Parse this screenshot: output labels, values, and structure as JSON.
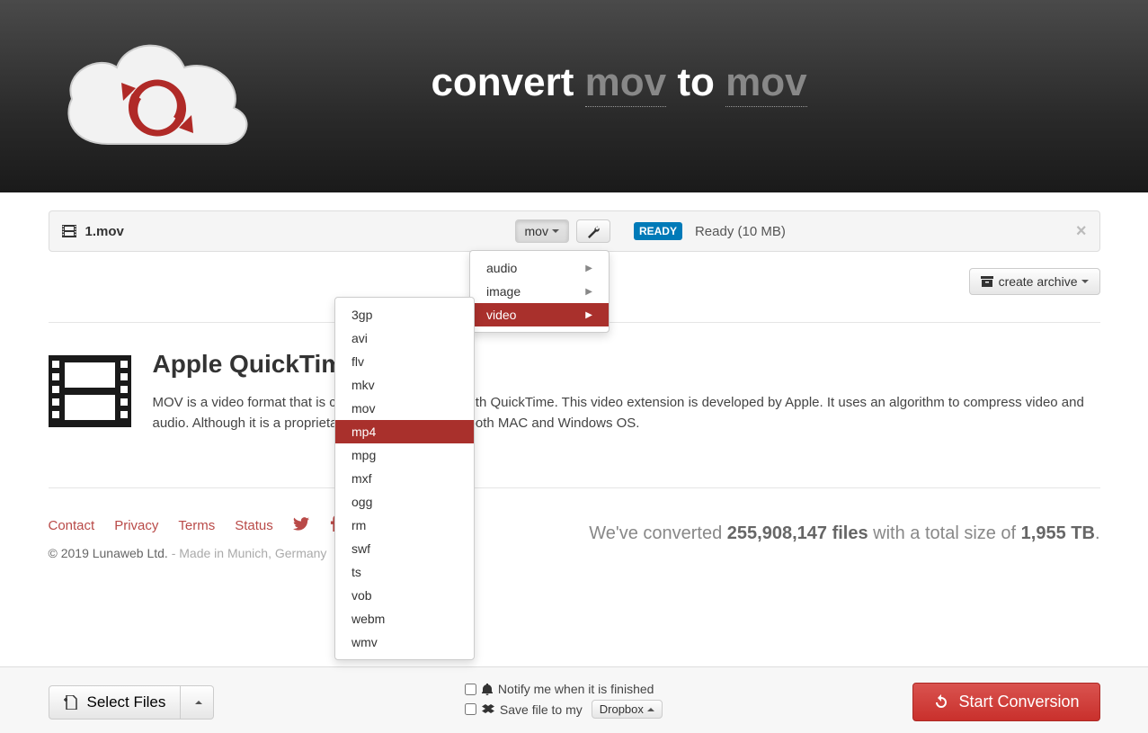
{
  "header": {
    "title_prefix": "convert ",
    "format_from": "mov",
    "title_middle": " to ",
    "format_to": "mov"
  },
  "file": {
    "name": "1.mov",
    "target_format": "mov",
    "status_badge": "READY",
    "status_text": "Ready (10 MB)"
  },
  "archive_button": "create archive",
  "description": {
    "heading": "Apple QuickTime",
    "body": "MOV is a video format that is commonly associated with QuickTime. This video extension is developed by Apple. It uses an algorithm to compress video and audio. Although it is a proprietary of Apple, it runs on both MAC and Windows OS."
  },
  "category_menu": [
    {
      "label": "audio",
      "selected": false
    },
    {
      "label": "image",
      "selected": false
    },
    {
      "label": "video",
      "selected": true
    }
  ],
  "format_menu": [
    {
      "label": "3gp",
      "selected": false
    },
    {
      "label": "avi",
      "selected": false
    },
    {
      "label": "flv",
      "selected": false
    },
    {
      "label": "mkv",
      "selected": false
    },
    {
      "label": "mov",
      "selected": false
    },
    {
      "label": "mp4",
      "selected": true
    },
    {
      "label": "mpg",
      "selected": false
    },
    {
      "label": "mxf",
      "selected": false
    },
    {
      "label": "ogg",
      "selected": false
    },
    {
      "label": "rm",
      "selected": false
    },
    {
      "label": "swf",
      "selected": false
    },
    {
      "label": "ts",
      "selected": false
    },
    {
      "label": "vob",
      "selected": false
    },
    {
      "label": "webm",
      "selected": false
    },
    {
      "label": "wmv",
      "selected": false
    }
  ],
  "footer": {
    "links": [
      "Contact",
      "Privacy",
      "Terms",
      "Status"
    ],
    "stats_prefix": "We've converted ",
    "stats_files": "255,908,147 files",
    "stats_middle": " with a total size of ",
    "stats_size": "1,955 TB",
    "stats_suffix": ".",
    "copyright": "© 2019 Lunaweb Ltd. ",
    "made_in": "- Made in Munich, Germany"
  },
  "bottom": {
    "select_files": "Select Files",
    "notify": "Notify me when it is finished",
    "save_to": "Save file to my",
    "dropbox": "Dropbox",
    "start": "Start Conversion"
  }
}
